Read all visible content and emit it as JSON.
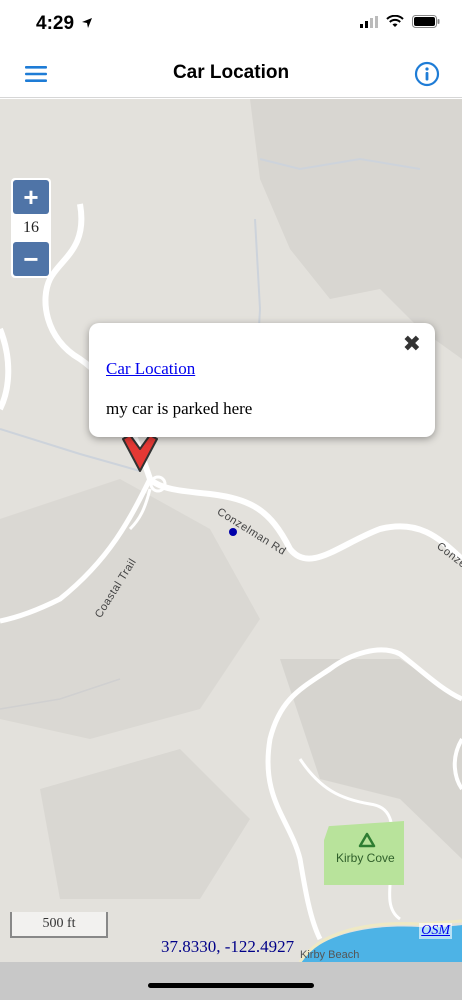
{
  "status": {
    "time": "4:29"
  },
  "nav": {
    "title": "Car Location",
    "menu_icon": "hamburger-menu-icon",
    "info_icon": "info-icon"
  },
  "zoom": {
    "plus": "+",
    "minus": "−",
    "level": "16"
  },
  "popup": {
    "close": "✖",
    "link": "Car Location",
    "text": "my car is parked here"
  },
  "map": {
    "roads": {
      "conzelman": "Conzelman Rd",
      "conzelman_edge": "Conze",
      "coastal": "Coastal Trail"
    },
    "park": "Kirby Cove",
    "beach": "Kirby Beach",
    "scale": "500 ft",
    "coordinates": "37.8330, -122.4927",
    "attribution": "OSM"
  },
  "colors": {
    "accent": "#1e7cd6",
    "zoom_button": "#4f74a7",
    "marker": "#e53935",
    "water": "#4db3e6",
    "park": "#b8e39b"
  }
}
